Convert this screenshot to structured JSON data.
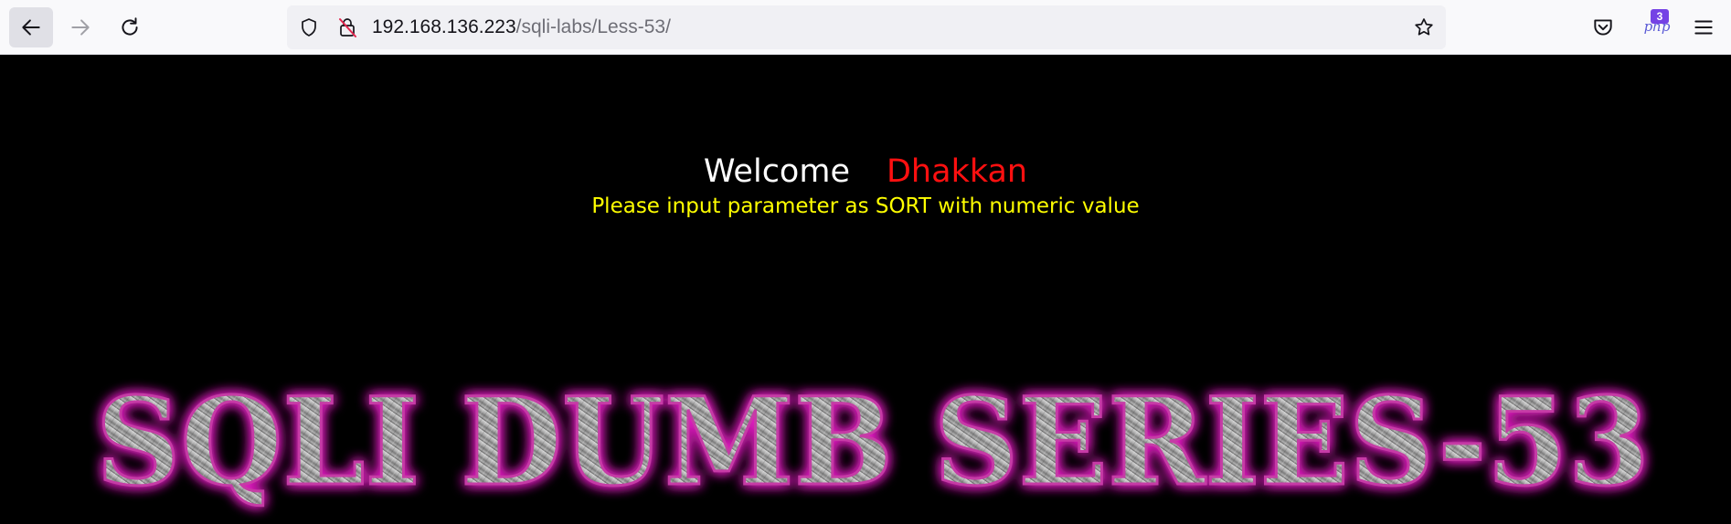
{
  "browser": {
    "url_host": "192.168.136.223",
    "url_path": "/sqli-labs/Less-53/",
    "extension_badge_count": "3",
    "extension_label": "php",
    "icons": [
      "back-icon",
      "forward-icon",
      "reload-icon",
      "shield-icon",
      "insecure-lock-icon",
      "bookmark-star-icon",
      "pocket-icon",
      "php-extension-icon",
      "menu-icon"
    ]
  },
  "page": {
    "welcome": "Welcome",
    "name": "Dhakkan",
    "instruction": "Please input parameter as SORT with numeric value",
    "banner_text": "SQLI DUMB SERIES-53"
  },
  "colors": {
    "page_background": "#000000",
    "welcome": "#ffffff",
    "name": "#ff1010",
    "instruction": "#ffff00",
    "banner_glow": "#e020c0"
  }
}
